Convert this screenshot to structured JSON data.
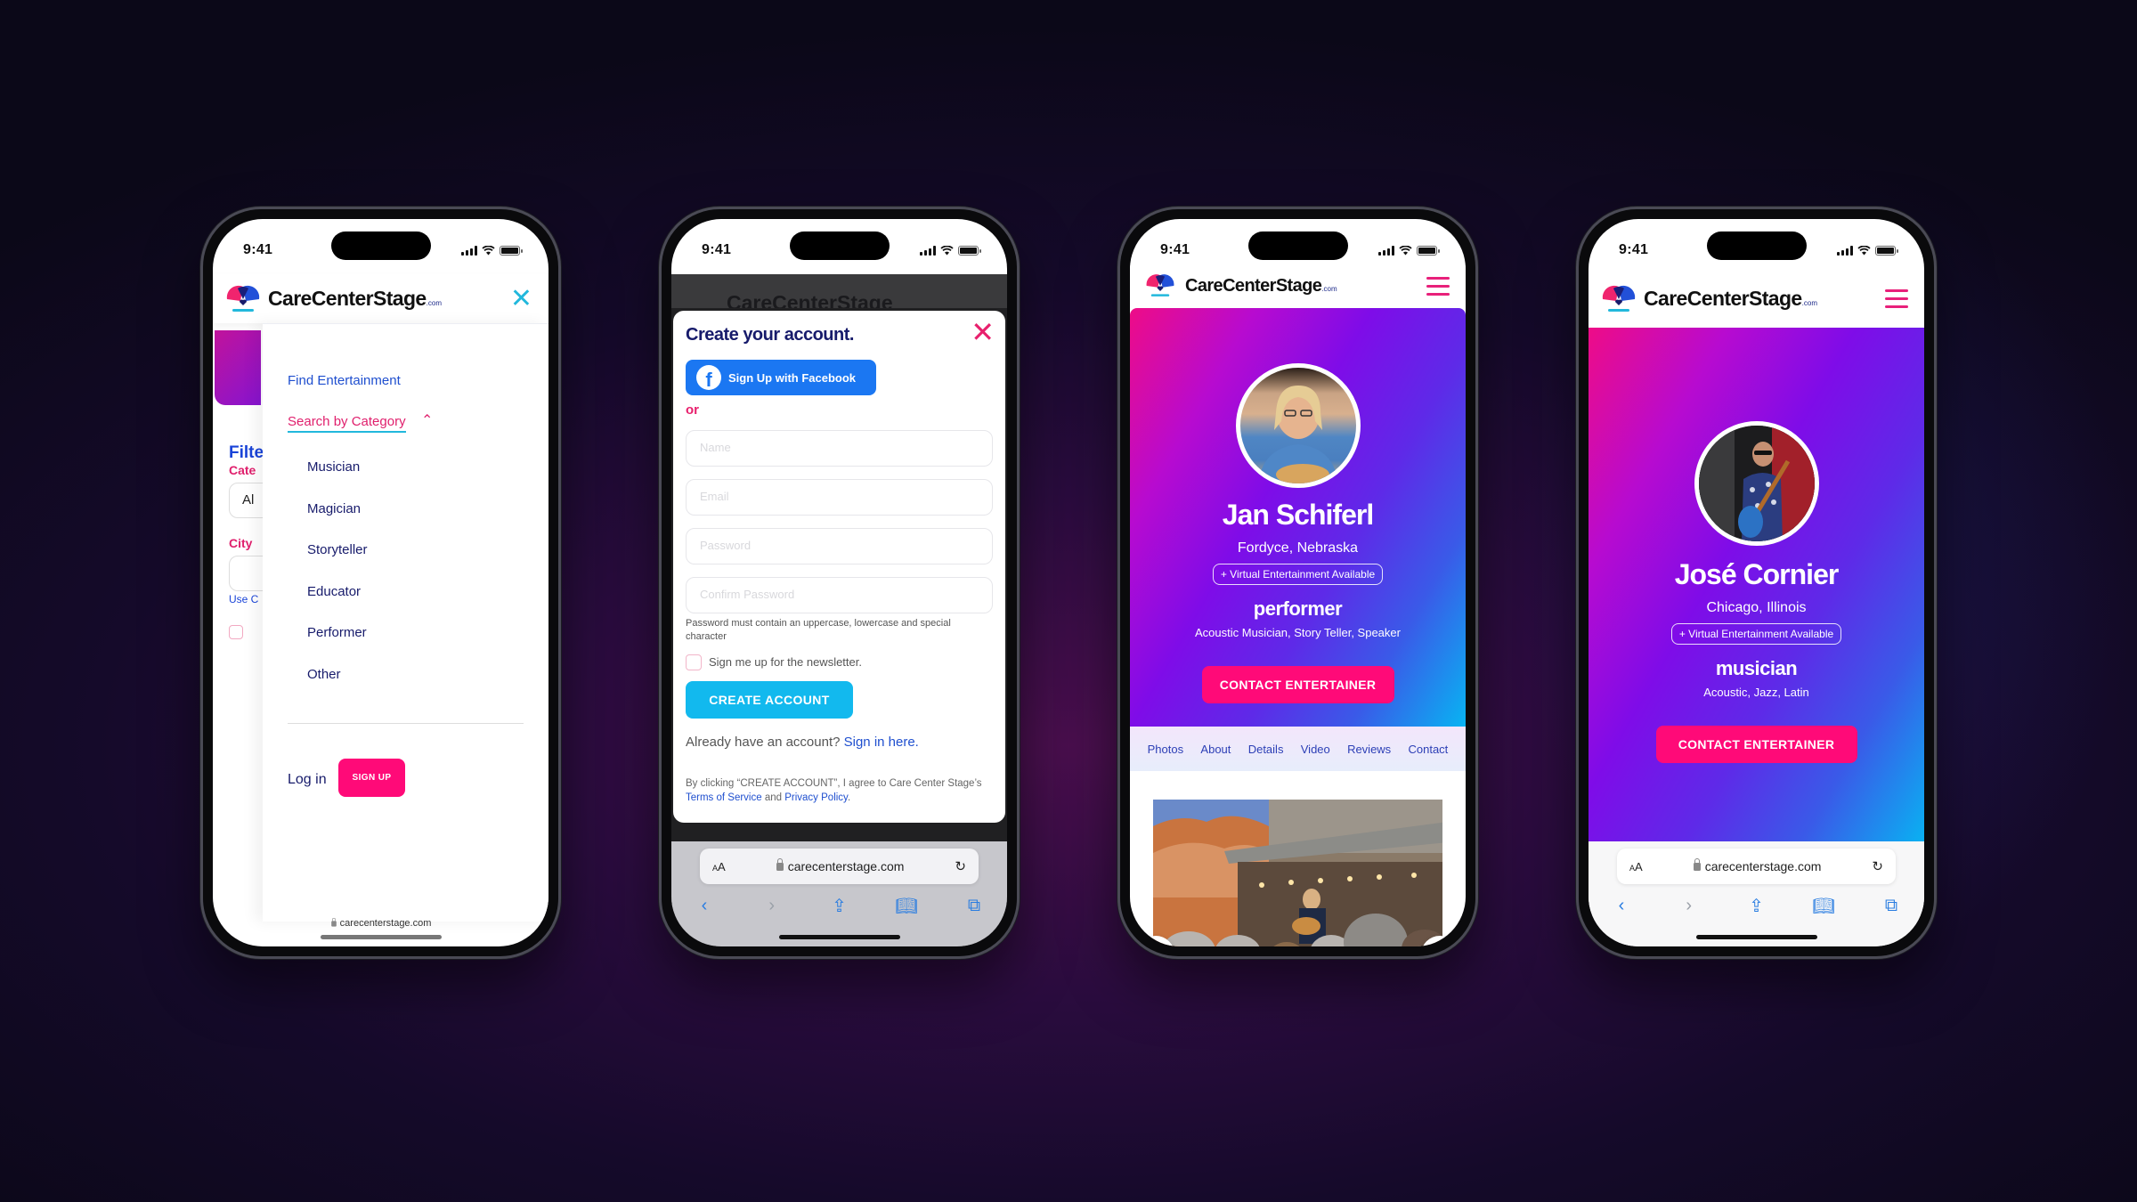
{
  "status_bar": {
    "time": "9:41"
  },
  "brand": {
    "name": "CareCenterStage",
    "tld": ".com",
    "url": "carecenterstage.com"
  },
  "colors": {
    "brand_pink": "#ff0a78",
    "brand_navy": "#171b6b",
    "brand_blue": "#1f4fcf",
    "accent_cyan": "#12b9ee",
    "facebook_blue": "#1b77f2"
  },
  "phone1": {
    "menu": {
      "find_entertainment": "Find Entertainment",
      "search_by_category": "Search by Category",
      "categories": [
        "Musician",
        "Magician",
        "Storyteller",
        "Educator",
        "Performer",
        "Other"
      ],
      "login": "Log in",
      "signup": "SIGN UP"
    },
    "background": {
      "filter_title": "Filte",
      "category_label": "Cate",
      "category_value": "Al",
      "city_label": "City",
      "use_label": "Use C"
    },
    "icons": {
      "close": "close-icon",
      "chevron_up": "chevron-up-icon"
    }
  },
  "phone2": {
    "title": "Create your account.",
    "facebook_button": "Sign Up with Facebook",
    "or": "or",
    "fields": [
      {
        "placeholder": "Name"
      },
      {
        "placeholder": "Email"
      },
      {
        "placeholder": "Password"
      },
      {
        "placeholder": "Confirm Password"
      }
    ],
    "password_hint": "Password must contain an uppercase, lowercase and special character",
    "newsletter": "Sign me up for the newsletter.",
    "create_button": "CREATE ACCOUNT",
    "already_text": "Already have an account?",
    "sign_in_link": "Sign in here.",
    "terms_prefix": "By clicking “CREATE ACCOUNT”, I agree to Care Center Stage’s",
    "terms_link": "Terms of Service",
    "terms_and": "and",
    "privacy_link": "Privacy Policy",
    "terms_suffix": "."
  },
  "phone3": {
    "name": "Jan Schiferl",
    "location": "Fordyce, Nebraska",
    "virtual_badge": "+ Virtual Entertainment Available",
    "type": "performer",
    "tags": "Acoustic Musician, Story Teller, Speaker",
    "contact_button": "CONTACT ENTERTAINER",
    "tabs": [
      "Photos",
      "About",
      "Details",
      "Video",
      "Reviews",
      "Contact"
    ]
  },
  "phone4": {
    "name": "José Cornier",
    "location": "Chicago, Illinois",
    "virtual_badge": "+ Virtual Entertainment Available",
    "type": "musician",
    "tags": "Acoustic, Jazz, Latin",
    "contact_button": "CONTACT ENTERTAINER"
  },
  "safari": {
    "aa_label": "AA",
    "url": "carecenterstage.com"
  }
}
